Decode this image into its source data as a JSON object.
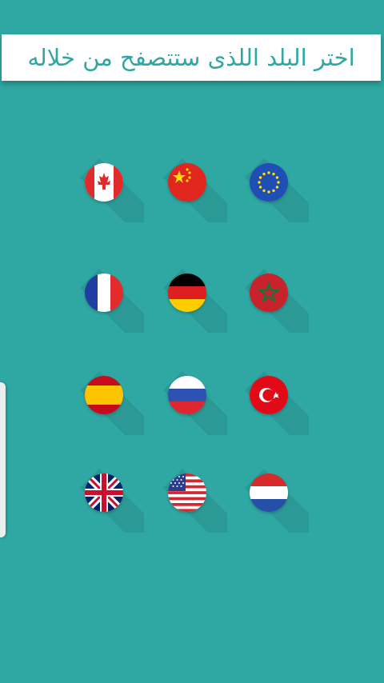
{
  "banner": {
    "title": "اختر البلد اللذى ستتصفح من خلاله"
  },
  "flags": [
    {
      "icon": "canada-flag-icon"
    },
    {
      "icon": "china-flag-icon"
    },
    {
      "icon": "european-union-flag-icon"
    },
    {
      "icon": "france-flag-icon"
    },
    {
      "icon": "germany-flag-icon"
    },
    {
      "icon": "morocco-flag-icon"
    },
    {
      "icon": "spain-flag-icon"
    },
    {
      "icon": "russia-flag-icon"
    },
    {
      "icon": "turkey-flag-icon"
    },
    {
      "icon": "united-kingdom-flag-icon"
    },
    {
      "icon": "united-states-flag-icon"
    },
    {
      "icon": "netherlands-flag-icon"
    }
  ],
  "colors": {
    "background": "#2fa7a2",
    "banner": "#ffffff",
    "accent_text": "#2fa7a2"
  }
}
